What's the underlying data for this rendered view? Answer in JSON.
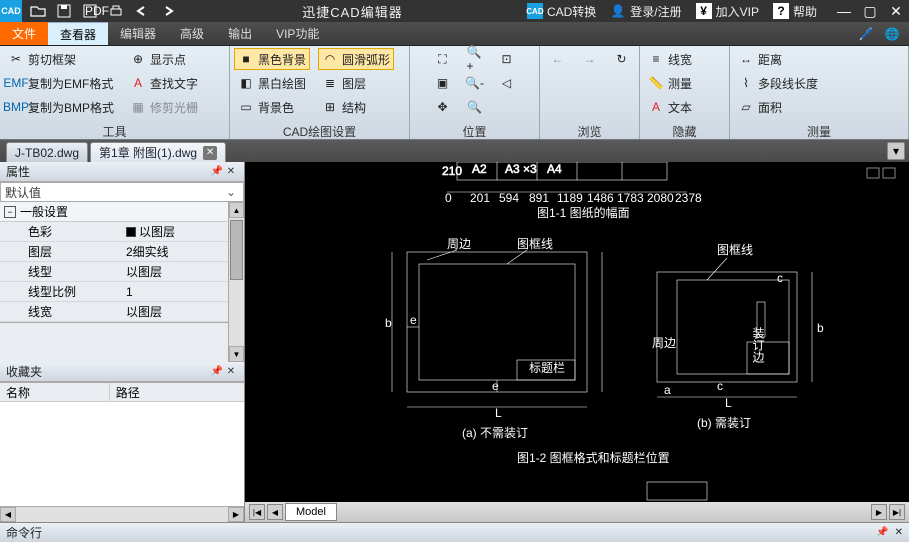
{
  "titlebar": {
    "app_title": "迅捷CAD编辑器",
    "cad_convert": "CAD转换",
    "login": "登录/注册",
    "vip": "加入VIP",
    "help": "帮助"
  },
  "menu": {
    "file": "文件",
    "viewer": "查看器",
    "editor": "编辑器",
    "advanced": "高级",
    "output": "输出",
    "vip_fn": "VIP功能"
  },
  "ribbon": {
    "tools_group": "工具",
    "clip_frame": "剪切框架",
    "copy_emf": "复制为EMF格式",
    "copy_bmp": "复制为BMP格式",
    "show_point": "显示点",
    "find_text": "查找文字",
    "fix_cursor": "修剪光栅",
    "cad_group": "CAD绘图设置",
    "black_bg": "黑色背景",
    "bw_draw": "黑白绘图",
    "bg_color": "背景色",
    "smooth_arc": "圆滑弧形",
    "layers": "图层",
    "structure": "结构",
    "pos_group": "位置",
    "browse_group": "浏览",
    "hide_group": "隐藏",
    "line_width": "线宽",
    "measure": "测量",
    "text": "文本",
    "measure_group": "测量",
    "distance": "距离",
    "polyline_len": "多段线长度",
    "area": "面积"
  },
  "doctabs": {
    "tab1": "J-TB02.dwg",
    "tab2": "第1章 附图(1).dwg"
  },
  "props": {
    "title": "属性",
    "default": "默认值",
    "general": "一般设置",
    "color_k": "色彩",
    "color_v": "以图层",
    "layer_k": "图层",
    "layer_v": "2细实线",
    "ltype_k": "线型",
    "ltype_v": "以图层",
    "lscale_k": "线型比例",
    "lscale_v": "1",
    "lwidth_k": "线宽",
    "lwidth_v": "以图层"
  },
  "fav": {
    "title": "收藏夹",
    "col_name": "名称",
    "col_path": "路径"
  },
  "model_tab": "Model",
  "cmdline": "命令行",
  "chart_data": {
    "type": "diagram",
    "title_top": "图1-1 图纸的幅面",
    "ruler_ticks": [
      "0",
      "201",
      "594",
      "891",
      "1189",
      "1486",
      "1783",
      "2080",
      "2378"
    ],
    "ruler_start": "210",
    "boxes": [
      "A2",
      "A3 ×3",
      "A4"
    ],
    "fig_a": {
      "caption": "(a) 不需装订",
      "labels": [
        "周边",
        "图框线",
        "标题栏"
      ],
      "dims": [
        "e",
        "e",
        "L",
        "b"
      ]
    },
    "fig_b": {
      "caption": "(b) 需装订",
      "labels": [
        "图框线",
        "周边"
      ],
      "dims": [
        "a",
        "c",
        "c",
        "L",
        "b"
      ],
      "side_text": "装订边"
    },
    "title_bottom": "图1-2 图框格式和标题栏位置"
  }
}
